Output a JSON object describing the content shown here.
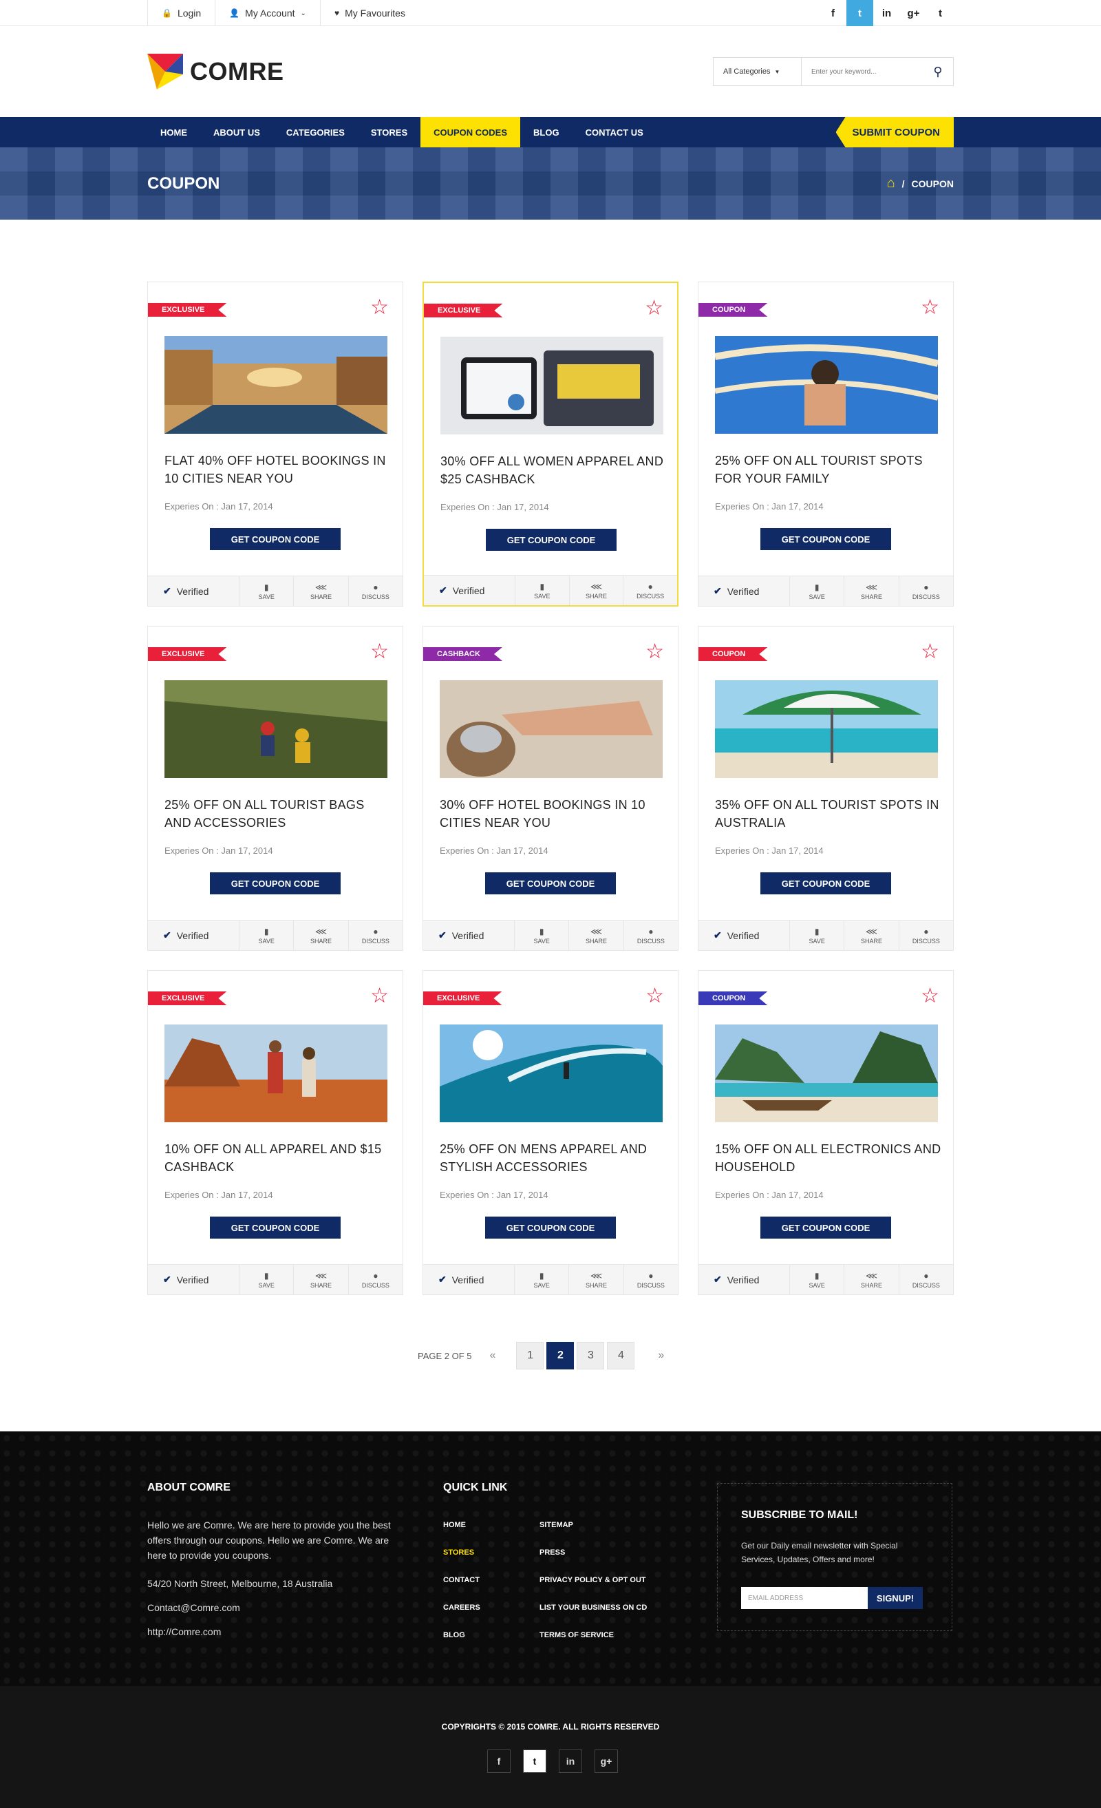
{
  "topbar": {
    "login": "Login",
    "account": "My Account",
    "favourites": "My Favourites",
    "socials": [
      {
        "icon": "facebook-icon",
        "glyph": "f"
      },
      {
        "icon": "twitter-icon",
        "glyph": "t"
      },
      {
        "icon": "linkedin-icon",
        "glyph": "in"
      },
      {
        "icon": "googleplus-icon",
        "glyph": "g+"
      },
      {
        "icon": "tumblr-icon",
        "glyph": "t"
      }
    ]
  },
  "header": {
    "logo": "COMRE",
    "category": "All Categories",
    "search_placeholder": "Enter your keyword..."
  },
  "nav": {
    "items": [
      "HOME",
      "ABOUT US",
      "CATEGORIES",
      "STORES",
      "COUPON CODES",
      "BLOG",
      "CONTACT US"
    ],
    "active": "COUPON CODES",
    "submit": "SUBMIT COUPON"
  },
  "banner": {
    "title": "COUPON",
    "crumb_sep": "/",
    "crumb": "COUPON"
  },
  "cards": [
    {
      "badge": "EXCLUSIVE",
      "badge_color": "#e8203a",
      "title": "FLAT 40% OFF HOTEL BOOKINGS IN 10 CITIES  NEAR YOU",
      "expires": "Experies On : Jan 17, 2014",
      "button": "GET COUPON CODE",
      "verified": "Verified",
      "save": "SAVE",
      "share": "SHARE",
      "discuss": "DISCUSS",
      "image": "venice-canal"
    },
    {
      "badge": "EXCLUSIVE",
      "badge_color": "#e8203a",
      "title": "30% OFF ALL WOMEN APPAREL AND $25 CASHBACK",
      "expires": "Experies On : Jan 17, 2014",
      "button": "GET COUPON CODE",
      "verified": "Verified",
      "save": "SAVE",
      "share": "SHARE",
      "discuss": "DISCUSS",
      "image": "cash-register"
    },
    {
      "badge": "COUPON",
      "badge_color": "#8e2aa8",
      "title": "25% OFF ON ALL TOURIST SPOTS FOR YOUR FAMILY",
      "expires": "Experies On : Jan 17, 2014",
      "button": "GET COUPON CODE",
      "verified": "Verified",
      "save": "SAVE",
      "share": "SHARE",
      "discuss": "DISCUSS",
      "image": "water-slide"
    },
    {
      "badge": "EXCLUSIVE",
      "badge_color": "#e8203a",
      "title": "25% OFF ON ALL TOURIST BAGS AND ACCESSORIES",
      "expires": "Experies On : Jan 17, 2014",
      "button": "GET COUPON CODE",
      "verified": "Verified",
      "save": "SAVE",
      "share": "SHARE",
      "discuss": "DISCUSS",
      "image": "hikers"
    },
    {
      "badge": "CASHBACK",
      "badge_color": "#8e2aa8",
      "title": "30% OFF HOTEL BOOKINGS IN 10 CITIES  NEAR YOU",
      "expires": "Experies On : Jan 17, 2014",
      "button": "GET COUPON CODE",
      "verified": "Verified",
      "save": "SAVE",
      "share": "SHARE",
      "discuss": "DISCUSS",
      "image": "service-bell"
    },
    {
      "badge": "COUPON",
      "badge_color": "#e8203a",
      "title": "35% OFF ON ALL TOURIST SPOTS IN AUSTRALIA",
      "expires": "Experies On : Jan 17, 2014",
      "button": "GET COUPON CODE",
      "verified": "Verified",
      "save": "SAVE",
      "share": "SHARE",
      "discuss": "DISCUSS",
      "image": "beach-umbrella"
    },
    {
      "badge": "EXCLUSIVE",
      "badge_color": "#e8203a",
      "title": "10% OFF ON ALL APPAREL AND $15 CASHBACK",
      "expires": "Experies On : Jan 17, 2014",
      "button": "GET COUPON CODE",
      "verified": "Verified",
      "save": "SAVE",
      "share": "SHARE",
      "discuss": "DISCUSS",
      "image": "desert-couple"
    },
    {
      "badge": "EXCLUSIVE",
      "badge_color": "#e8203a",
      "title": "25% OFF ON MENS APPAREL AND STYLISH ACCESSORIES",
      "expires": "Experies On : Jan 17, 2014",
      "button": "GET COUPON CODE",
      "verified": "Verified",
      "save": "SAVE",
      "share": "SHARE",
      "discuss": "DISCUSS",
      "image": "surfer-wave"
    },
    {
      "badge": "COUPON",
      "badge_color": "#3a3ab8",
      "title": "15% OFF ON ALL ELECTRONICS AND HOUSEHOLD",
      "expires": "Experies On : Jan 17, 2014",
      "button": "GET COUPON CODE",
      "verified": "Verified",
      "save": "SAVE",
      "share": "SHARE",
      "discuss": "DISCUSS",
      "image": "tropical-boat"
    }
  ],
  "pagination": {
    "label": "PAGE 2 OF 5",
    "prev": "«",
    "next": "»",
    "pages": [
      "1",
      "2",
      "3",
      "4"
    ],
    "current": "2"
  },
  "footer": {
    "about_title": "ABOUT COMRE",
    "about_text": "Hello we are Comre. We are here to provide you the best offers through our coupons. Hello we are Comre. We are here to provide you coupons.",
    "address": "54/20  North Street, Melbourne, 18 Australia",
    "email": "Contact@Comre.com",
    "url": "http://Comre.com",
    "quick_title": "QUICK LINK",
    "links_left": [
      "HOME",
      "STORES",
      "CONTACT",
      "CAREERS",
      "BLOG"
    ],
    "links_right": [
      "SITEMAP",
      "PRESS",
      "PRIVACY POLICY & OPT OUT",
      "LIST YOUR BUSINESS ON CD",
      "TERMS OF SERVICE"
    ],
    "active_link": "STORES",
    "sub_title": "SUBSCRIBE TO MAIL!",
    "sub_text": "Get our Daily email newsletter with Special Services, Updates, Offers and more!",
    "sub_placeholder": "EMAIL ADDRESS",
    "sub_button": "SIGNUP!",
    "copyright": "COPYRIGHTS © 2015 COMRE. ALL RIGHTS RESERVED",
    "socials": [
      {
        "icon": "facebook-icon",
        "glyph": "f"
      },
      {
        "icon": "twitter-icon",
        "glyph": "t"
      },
      {
        "icon": "linkedin-icon",
        "glyph": "in"
      },
      {
        "icon": "googleplus-icon",
        "glyph": "g+"
      }
    ]
  }
}
